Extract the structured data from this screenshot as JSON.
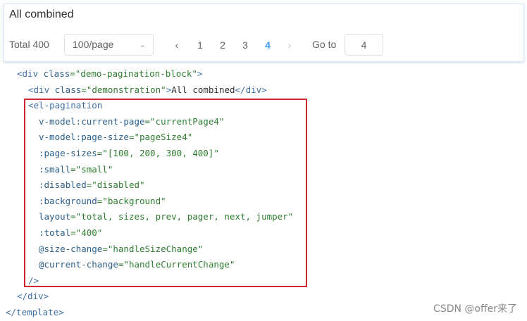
{
  "demo": {
    "title": "All combined",
    "total_text": "Total 400",
    "page_size": "100/page",
    "chevron": "⌄",
    "prev": "‹",
    "next": "›",
    "pages": [
      "1",
      "2",
      "3",
      "4"
    ],
    "current_page": "4",
    "goto_label": "Go to",
    "goto_value": "4"
  },
  "code": {
    "l1": {
      "a": "<div",
      "b": " class",
      "c": "=\"demo-pagination-block\"",
      "d": ">"
    },
    "l2": {
      "a": "<div",
      "b": " class",
      "c": "=\"demonstration\"",
      "d": ">",
      "e": "All combined",
      "f": "</div>"
    },
    "l3": {
      "a": "<el-pagination"
    },
    "l4": {
      "b": "v-model:current-page",
      "c": "=\"currentPage4\""
    },
    "l5": {
      "b": "v-model:page-size",
      "c": "=\"pageSize4\""
    },
    "l6": {
      "b": ":page-sizes",
      "c": "=\"[100, 200, 300, 400]\""
    },
    "l7": {
      "b": ":small",
      "c": "=\"small\""
    },
    "l8": {
      "b": ":disabled",
      "c": "=\"disabled\""
    },
    "l9": {
      "b": ":background",
      "c": "=\"background\""
    },
    "l10": {
      "b": "layout",
      "c": "=\"total, sizes, prev, pager, next, jumper\""
    },
    "l11": {
      "b": ":total",
      "c": "=\"400\""
    },
    "l12": {
      "b": "@size-change",
      "c": "=\"handleSizeChange\""
    },
    "l13": {
      "b": "@current-change",
      "c": "=\"handleCurrentChange\""
    },
    "l14": {
      "a": "/>"
    },
    "l15": {
      "a": "</div>"
    },
    "l16": {
      "a": "</template>"
    }
  },
  "watermark": "CSDN @offer来了",
  "colors": {
    "accent": "#409eff",
    "highlight_border": "#d0242f"
  }
}
